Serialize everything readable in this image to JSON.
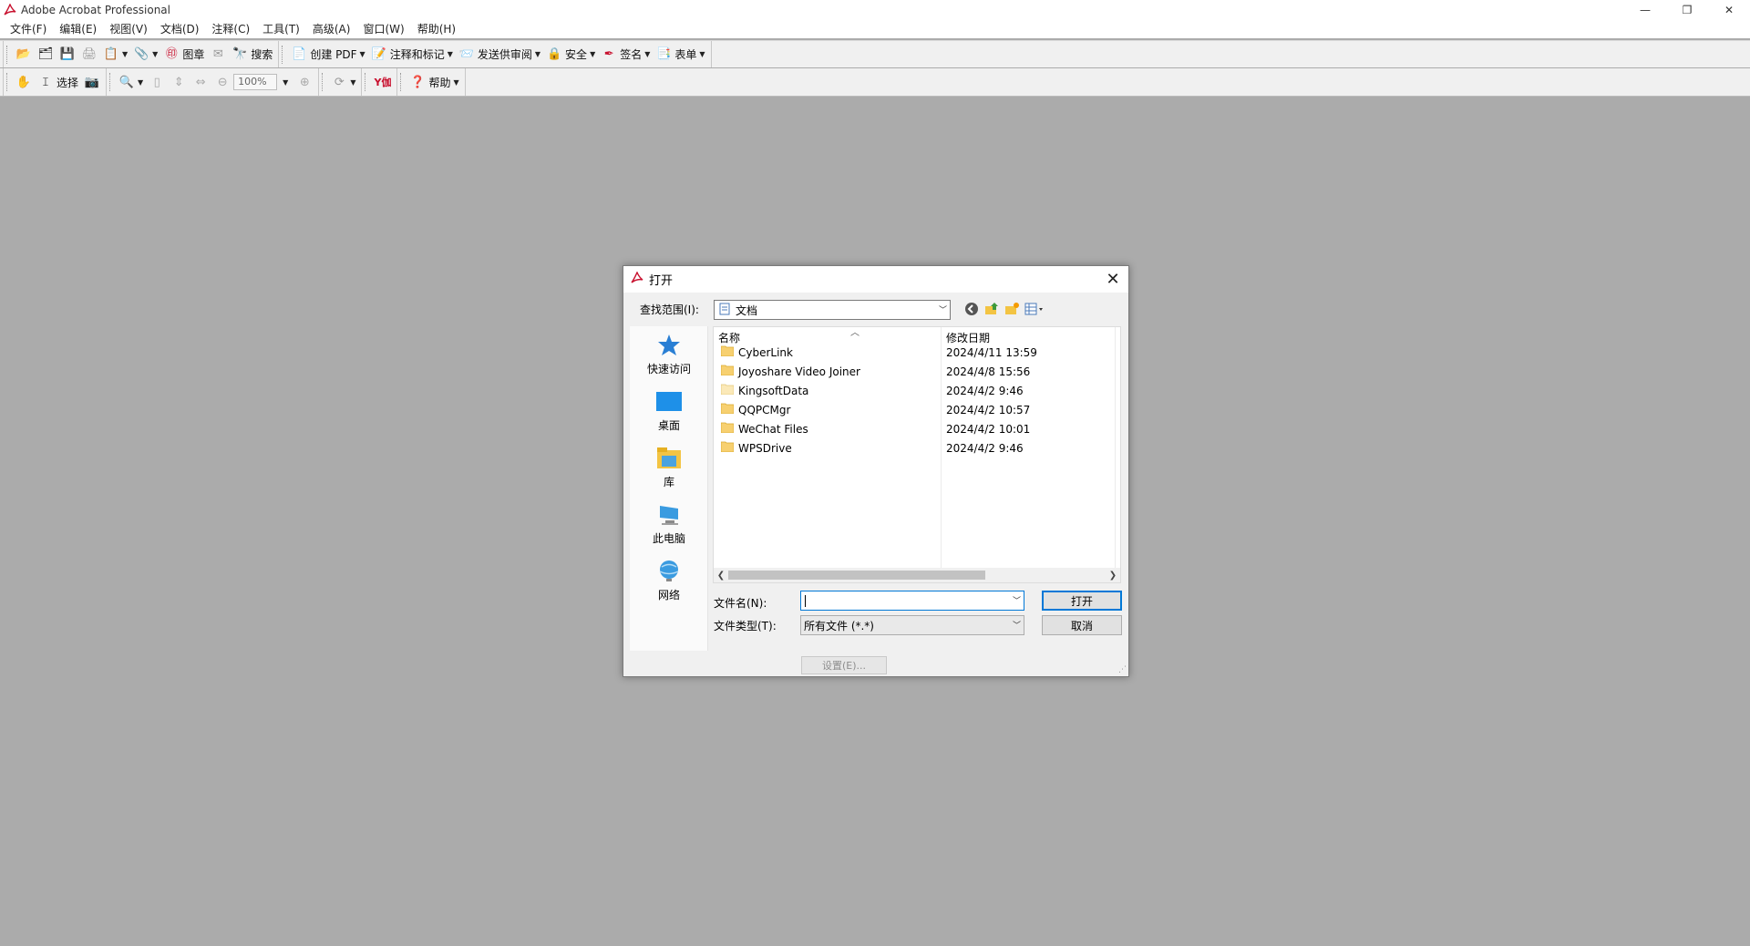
{
  "app": {
    "title": "Adobe Acrobat Professional"
  },
  "window_controls": {
    "minimize": "—",
    "restore": "❐",
    "close": "✕"
  },
  "menu": [
    "文件(F)",
    "编辑(E)",
    "视图(V)",
    "文档(D)",
    "注释(C)",
    "工具(T)",
    "高级(A)",
    "窗口(W)",
    "帮助(H)"
  ],
  "toolbar1": {
    "stamp": "图章",
    "search": "搜索",
    "create_pdf": "创建 PDF",
    "comment_markup": "注释和标记",
    "send_review": "发送供审阅",
    "security": "安全",
    "sign": "签名",
    "forms": "表单"
  },
  "toolbar2": {
    "select": "选择",
    "zoom": "100%",
    "help": "帮助",
    "youdao": "Y伽"
  },
  "dialog": {
    "title": "打开",
    "lookin_label": "查找范围(I):",
    "lookin_value": "文档",
    "places": [
      {
        "label": "快速访问",
        "icon": "star-icon"
      },
      {
        "label": "桌面",
        "icon": "desktop-icon"
      },
      {
        "label": "库",
        "icon": "library-icon"
      },
      {
        "label": "此电脑",
        "icon": "computer-icon"
      },
      {
        "label": "网络",
        "icon": "network-icon"
      }
    ],
    "columns": {
      "name": "名称",
      "modified": "修改日期"
    },
    "files": [
      {
        "name": "CyberLink",
        "date": "2024/4/11 13:59"
      },
      {
        "name": "Joyoshare Video Joiner",
        "date": "2024/4/8 15:56"
      },
      {
        "name": "KingsoftData",
        "date": "2024/4/2 9:46"
      },
      {
        "name": "QQPCMgr",
        "date": "2024/4/2 10:57"
      },
      {
        "name": "WeChat Files",
        "date": "2024/4/2 10:01"
      },
      {
        "name": "WPSDrive",
        "date": "2024/4/2 9:46"
      }
    ],
    "filename_label": "文件名(N):",
    "filename_value": "",
    "filetype_label": "文件类型(T):",
    "filetype_value": "所有文件 (*.*)",
    "open_button": "打开",
    "cancel_button": "取消",
    "settings_button": "设置(E)..."
  },
  "colors": {
    "accent": "#0078d7",
    "workspace": "#ababab",
    "folder": "#f7d070"
  }
}
